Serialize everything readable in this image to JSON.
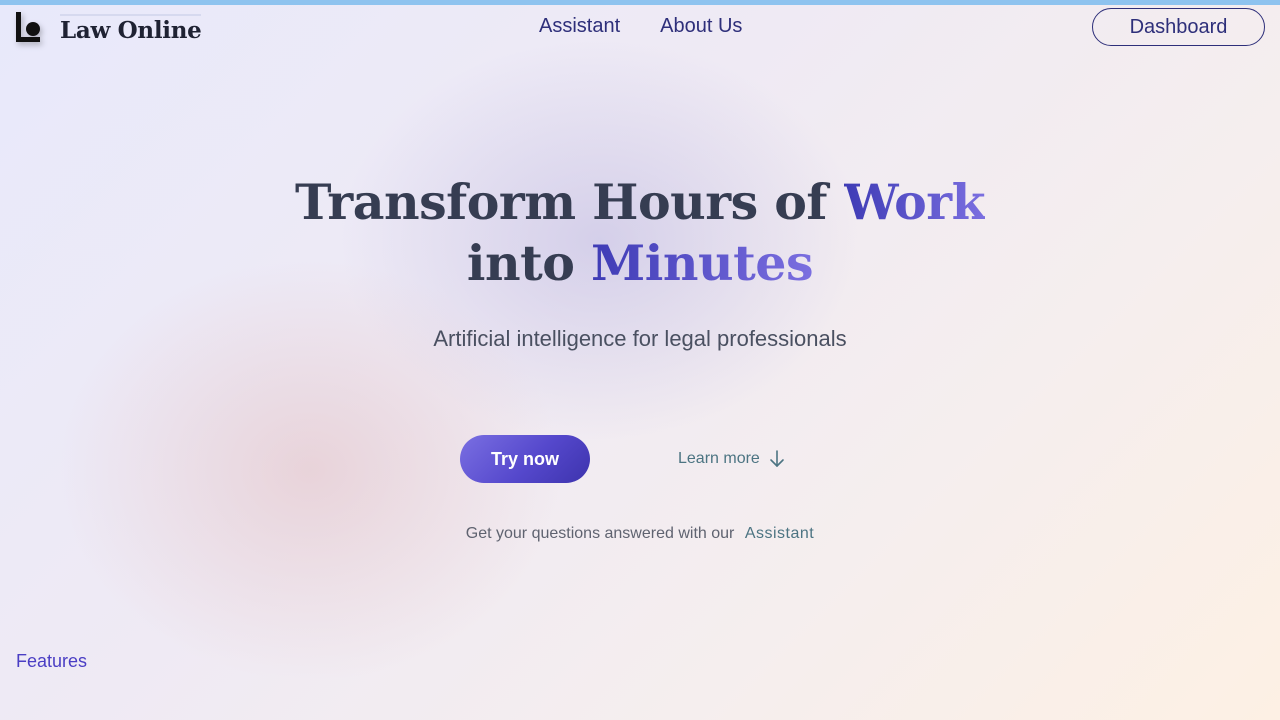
{
  "brand": {
    "name": "Law Online",
    "logo_icon": "law-online-logo-mark"
  },
  "nav": {
    "items": [
      {
        "label": "Assistant"
      },
      {
        "label": "About Us"
      }
    ],
    "dashboard_label": "Dashboard"
  },
  "hero": {
    "title_part1": "Transform Hours of ",
    "title_accent1": "Work",
    "title_part2": "into ",
    "title_accent2": "Minutes",
    "subtitle": "Artificial intelligence for legal professionals",
    "try_label": "Try now",
    "learn_label": "Learn more",
    "learn_icon": "arrow-down-icon",
    "helper_text": "Get your questions answered with our",
    "helper_link": "Assistant"
  },
  "footer": {
    "features_label": "Features"
  },
  "colors": {
    "accent": "#4f46c8",
    "nav_text": "#2e2f7a",
    "top_bar": "#8ec3ef",
    "link": "#4c7482"
  }
}
